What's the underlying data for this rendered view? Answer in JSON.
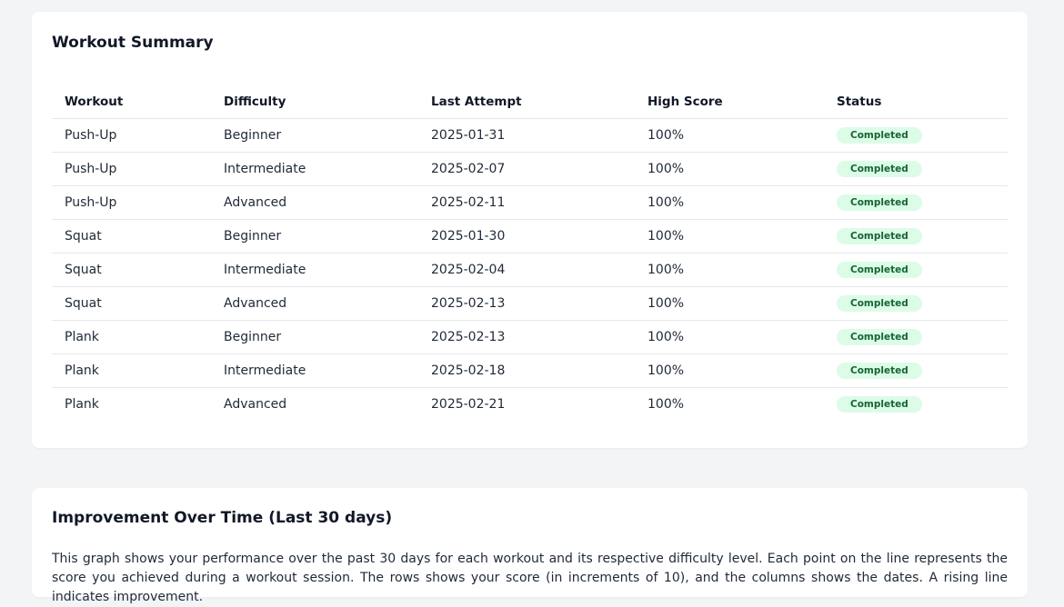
{
  "summary": {
    "title": "Workout Summary",
    "columns": {
      "workout": "Workout",
      "difficulty": "Difficulty",
      "last_attempt": "Last Attempt",
      "high_score": "High Score",
      "status": "Status"
    },
    "rows": [
      {
        "workout": "Push-Up",
        "difficulty": "Beginner",
        "last_attempt": "2025-01-31",
        "high_score": "100%",
        "status": "Completed"
      },
      {
        "workout": "Push-Up",
        "difficulty": "Intermediate",
        "last_attempt": "2025-02-07",
        "high_score": "100%",
        "status": "Completed"
      },
      {
        "workout": "Push-Up",
        "difficulty": "Advanced",
        "last_attempt": "2025-02-11",
        "high_score": "100%",
        "status": "Completed"
      },
      {
        "workout": "Squat",
        "difficulty": "Beginner",
        "last_attempt": "2025-01-30",
        "high_score": "100%",
        "status": "Completed"
      },
      {
        "workout": "Squat",
        "difficulty": "Intermediate",
        "last_attempt": "2025-02-04",
        "high_score": "100%",
        "status": "Completed"
      },
      {
        "workout": "Squat",
        "difficulty": "Advanced",
        "last_attempt": "2025-02-13",
        "high_score": "100%",
        "status": "Completed"
      },
      {
        "workout": "Plank",
        "difficulty": "Beginner",
        "last_attempt": "2025-02-13",
        "high_score": "100%",
        "status": "Completed"
      },
      {
        "workout": "Plank",
        "difficulty": "Intermediate",
        "last_attempt": "2025-02-18",
        "high_score": "100%",
        "status": "Completed"
      },
      {
        "workout": "Plank",
        "difficulty": "Advanced",
        "last_attempt": "2025-02-21",
        "high_score": "100%",
        "status": "Completed"
      }
    ]
  },
  "improvement": {
    "title": "Improvement Over Time (Last 30 days)",
    "description": "This graph shows your performance over the past 30 days for each workout and its respective difficulty level. Each point on the line represents the score you achieved during a workout session. The rows shows your score (in increments of 10), and the columns shows the dates. A rising line indicates improvement."
  },
  "colors": {
    "page_background": "#f3f4f6",
    "card_background": "#ffffff",
    "badge_background": "#dcfce7",
    "badge_text": "#166534"
  }
}
